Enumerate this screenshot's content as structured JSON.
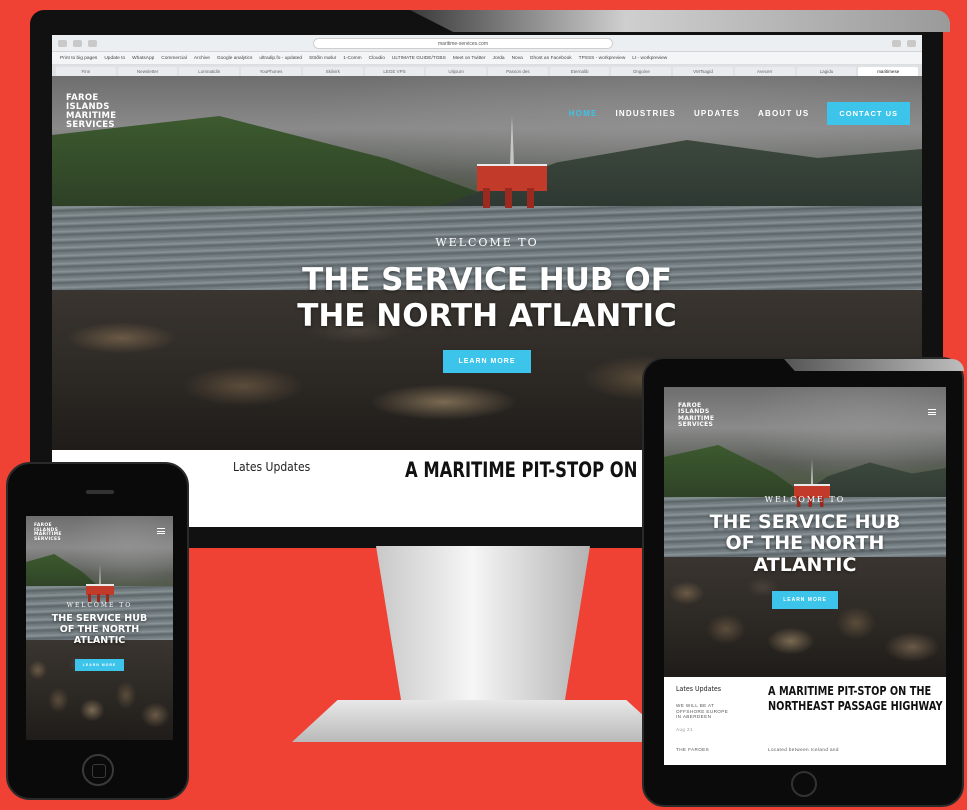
{
  "site": {
    "logo": [
      "FAROE",
      "ISLANDS",
      "MARITIME",
      "SERVICES"
    ],
    "nav": [
      "HOME",
      "INDUSTRIES",
      "UPDATES",
      "ABOUT US"
    ],
    "contact": "CONTACT US",
    "welcome": "WELCOME TO",
    "headline_line1": "THE SERVICE HUB OF",
    "headline_line2": "THE NORTH ATLANTIC",
    "cta": "LEARN MORE",
    "updates_label": "Lates Updates",
    "article_title": "A MARITIME PIT-STOP ON THE",
    "article_title_full": "A MARITIME PIT-STOP ON THE NORTHEAST PASSAGE HIGHWAY"
  },
  "phone": {
    "headline": [
      "THE SERVICE HUB",
      "OF THE NORTH",
      "ATLANTIC"
    ]
  },
  "tablet": {
    "headline": [
      "THE SERVICE HUB",
      "OF THE NORTH",
      "ATLANTIC"
    ],
    "update_snippet": [
      "WE WILL BE AT",
      "OFFSHORE EUROPE",
      "IN ABERDEEN"
    ],
    "update_date": "Aug 21",
    "second_snippet": "THE FAROES",
    "article_line": "Located between Iceland and"
  },
  "browser": {
    "url": "maritime-services.com",
    "bookmarks": [
      "Print to big pages",
      "Update to",
      "WhatsApp",
      "Commercial",
      "Archive",
      "Google analytics",
      "ultradip.fo - updated",
      "Stöðin mølur",
      "1-Comm",
      "Cloudio",
      "ULTIMATE GUIDE/TGBS",
      "Meet on Twitter",
      "Jorda",
      "Nova",
      "Ghost an Facebook",
      "TPSSS - workpreview",
      "Lt - workpreview"
    ],
    "tabs": [
      "Finn",
      "Newsletter",
      "Lomnatidin",
      "YouPhones",
      "Skilvirk",
      "LEGE VPS",
      "Uitjourn",
      "Passon des",
      "Eternalib",
      "Ongoine",
      "VMTsagid",
      "Avecerr",
      "Lagidu",
      "maritimese"
    ]
  }
}
